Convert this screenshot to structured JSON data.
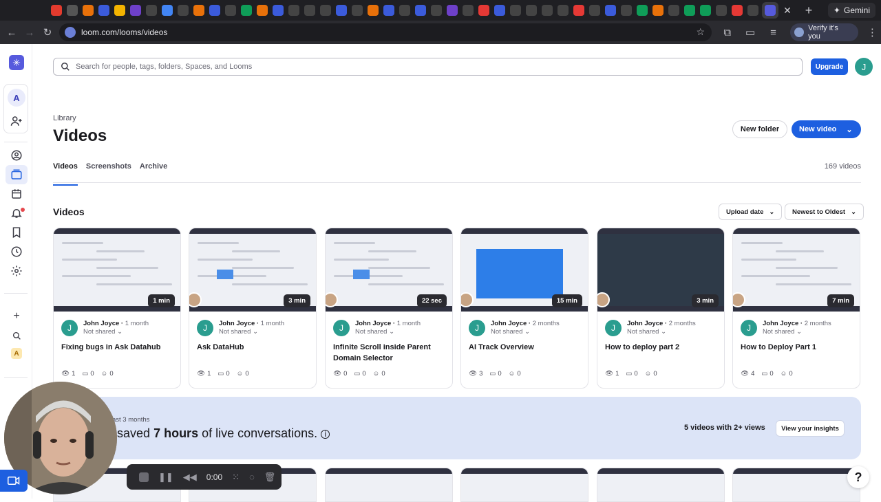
{
  "browser": {
    "url": "loom.com/looms/videos",
    "verify_label": "Verify it's you",
    "gemini_label": "Gemini",
    "favicon_colors": [
      "#e33b2e",
      "#555",
      "#e8710a",
      "#3b5bdb",
      "#f4b400",
      "#6e40c9",
      "#444",
      "#4285f4",
      "#444",
      "#e8710a",
      "#3b5bdb",
      "#444",
      "#0f9d58",
      "#e8710a",
      "#3b5bdb",
      "#444",
      "#444",
      "#444",
      "#3b5bdb",
      "#444",
      "#e8710a",
      "#3b5bdb",
      "#444",
      "#3b5bdb",
      "#444",
      "#6e40c9",
      "#444",
      "#e53935",
      "#3b5bdb",
      "#444",
      "#444",
      "#444",
      "#444",
      "#e53935",
      "#444",
      "#3b5bdb",
      "#444",
      "#0f9d58",
      "#e8710a",
      "#444",
      "#0f9d58",
      "#0f9d58",
      "#444",
      "#e53935",
      "#444"
    ]
  },
  "search": {
    "placeholder": "Search for people, tags, folders, Spaces, and Looms"
  },
  "header": {
    "upgrade_label": "Upgrade",
    "avatar_initial": "J"
  },
  "sidebar": {
    "workspace_initial": "A",
    "workspace_initial_small": "A"
  },
  "page": {
    "breadcrumb": "Library",
    "title": "Videos",
    "new_folder_label": "New folder",
    "new_video_label": "New video",
    "tabs": [
      "Videos",
      "Screenshots",
      "Archive"
    ],
    "video_count": "169 videos",
    "section_title": "Videos",
    "sort_field": "Upload date",
    "sort_order": "Newest to Oldest"
  },
  "videos": [
    {
      "author": "John Joyce",
      "age": "1 month",
      "share": "Not shared",
      "title": "Fixing bugs in Ask Datahub",
      "duration": "1 min",
      "views": "1",
      "comments": "0",
      "reactions": "0"
    },
    {
      "author": "John Joyce",
      "age": "1 month",
      "share": "Not shared",
      "title": "Ask DataHub",
      "duration": "3 min",
      "views": "1",
      "comments": "0",
      "reactions": "0"
    },
    {
      "author": "John Joyce",
      "age": "1 month",
      "share": "Not shared",
      "title": "Infinite Scroll inside Parent Domain Selector",
      "duration": "22 sec",
      "views": "0",
      "comments": "0",
      "reactions": "0"
    },
    {
      "author": "John Joyce",
      "age": "2 months",
      "share": "Not shared",
      "title": "AI Track Overview",
      "duration": "15 min",
      "views": "3",
      "comments": "0",
      "reactions": "0"
    },
    {
      "author": "John Joyce",
      "age": "2 months",
      "share": "Not shared",
      "title": "How to deploy part 2",
      "duration": "3 min",
      "views": "1",
      "comments": "0",
      "reactions": "0"
    },
    {
      "author": "John Joyce",
      "age": "2 months",
      "share": "Not shared",
      "title": "How to Deploy Part 1",
      "duration": "7 min",
      "views": "4",
      "comments": "0",
      "reactions": "0"
    }
  ],
  "insights": {
    "period": "ast 3 months",
    "saved_prefix": "saved",
    "saved_hours": "7 hours",
    "saved_suffix": "of live conversations.",
    "views_summary": "5 videos with 2+ views",
    "button_label": "View your insights"
  },
  "recorder": {
    "time": "0:00"
  },
  "help_label": "?"
}
